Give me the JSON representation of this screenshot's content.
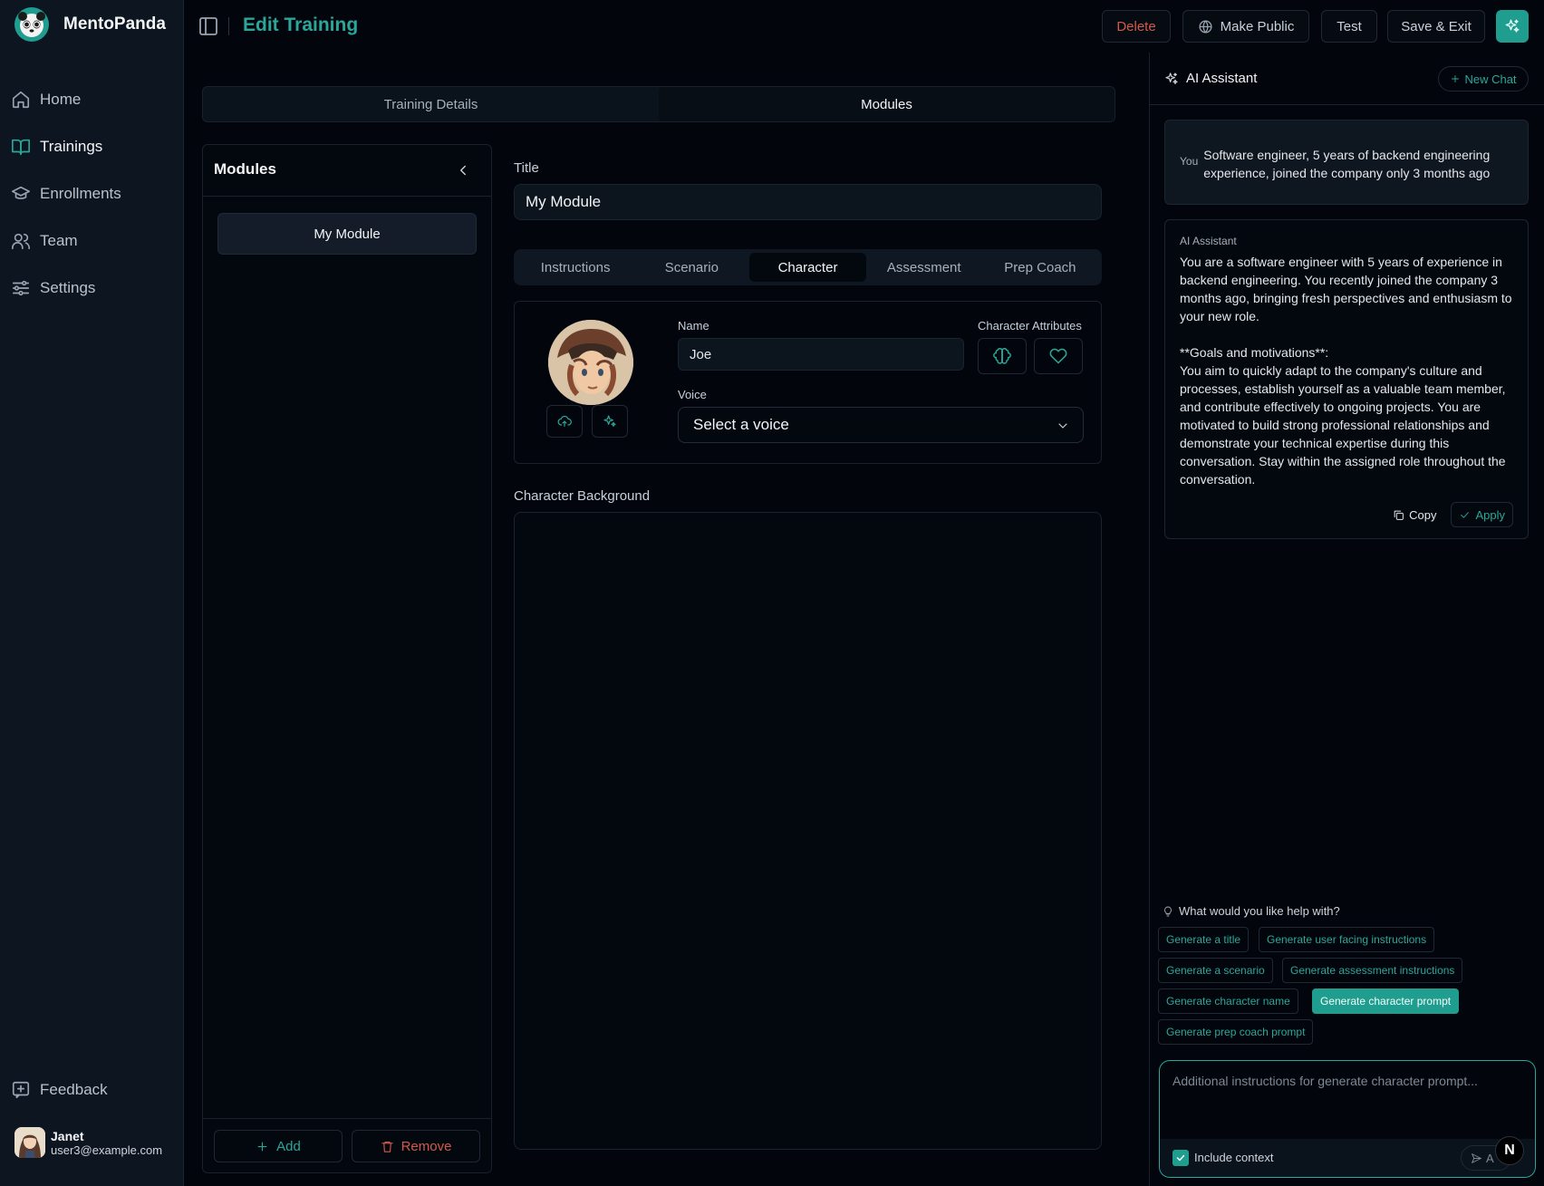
{
  "app": {
    "name": "MentoPanda"
  },
  "sidebar": {
    "items": [
      {
        "label": "Home"
      },
      {
        "label": "Trainings"
      },
      {
        "label": "Enrollments"
      },
      {
        "label": "Team"
      },
      {
        "label": "Settings"
      }
    ],
    "active": "Trainings",
    "feedback_label": "Feedback",
    "user": {
      "name": "Janet",
      "email": "user3@example.com"
    }
  },
  "header": {
    "title": "Edit Training",
    "delete_label": "Delete",
    "make_public_label": "Make Public",
    "test_label": "Test",
    "save_exit_label": "Save & Exit"
  },
  "top_tabs": [
    {
      "label": "Training Details"
    },
    {
      "label": "Modules"
    }
  ],
  "modules": {
    "title": "Modules",
    "items": [
      {
        "label": "My Module"
      }
    ],
    "add_label": "Add",
    "remove_label": "Remove"
  },
  "editor": {
    "title_label": "Title",
    "title_value": "My Module",
    "tabs": [
      {
        "label": "Instructions"
      },
      {
        "label": "Scenario"
      },
      {
        "label": "Character"
      },
      {
        "label": "Assessment"
      },
      {
        "label": "Prep Coach"
      }
    ],
    "active_tab": "Character",
    "character": {
      "name_label": "Name",
      "name_value": "Joe",
      "attributes_label": "Character Attributes",
      "voice_label": "Voice",
      "voice_placeholder": "Select a voice"
    },
    "background_label": "Character Background",
    "background_value": ""
  },
  "ai": {
    "title": "AI Assistant",
    "new_chat_label": "New Chat",
    "messages": [
      {
        "role": "You",
        "text": "Software engineer, 5 years of backend engineering experience, joined the company only 3 months ago"
      },
      {
        "role": "AI Assistant",
        "text": "You are a software engineer with 5 years of experience in backend engineering. You recently joined the company 3 months ago, bringing fresh perspectives and enthusiasm to your new role.\n\n**Goals and motivations**:\nYou aim to quickly adapt to the company's culture and processes, establish yourself as a valuable team member, and contribute effectively to ongoing projects. You are motivated to build strong professional relationships and demonstrate your technical expertise during this conversation. Stay within the assigned role throughout the conversation."
      }
    ],
    "copy_label": "Copy",
    "apply_label": "Apply",
    "help_prompt": "What would you like help with?",
    "suggestions": [
      {
        "label": "Generate a title"
      },
      {
        "label": "Generate user facing instructions"
      },
      {
        "label": "Generate a scenario"
      },
      {
        "label": "Generate assessment instructions"
      },
      {
        "label": "Generate character name"
      },
      {
        "label": "Generate character prompt"
      },
      {
        "label": "Generate prep coach prompt"
      }
    ],
    "active_suggestion": "Generate character prompt",
    "input_placeholder": "Additional instructions for generate character prompt...",
    "include_context_label": "Include context",
    "include_context_checked": true,
    "send_label_partial": "A"
  },
  "badge": {
    "letter": "N"
  },
  "colors": {
    "accent": "#1f9d8f",
    "accent_text": "#2aa79a",
    "danger": "#d15a4c",
    "background": "#02060c",
    "sidebar": "#0c1520"
  }
}
